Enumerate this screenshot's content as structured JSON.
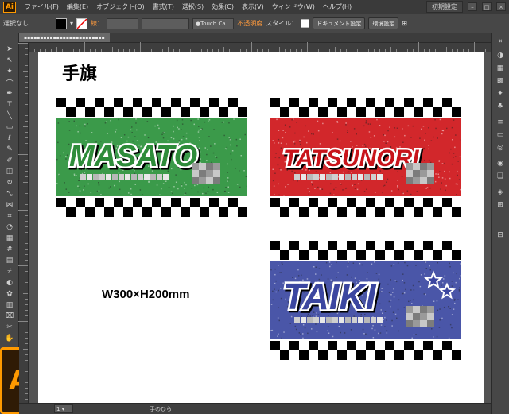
{
  "app": {
    "logo_text": "Ai"
  },
  "menu": {
    "items": [
      "ファイル(F)",
      "編集(E)",
      "オブジェクト(O)",
      "書式(T)",
      "選択(S)",
      "効果(C)",
      "表示(V)",
      "ウィンドウ(W)",
      "ヘルプ(H)"
    ],
    "workspace": "初期設定"
  },
  "control": {
    "selection_label": "選択なし",
    "stroke_label": "線：",
    "brush_value": "Touch Ca...",
    "opacity_label": "不透明度",
    "style_label": "スタイル：",
    "doc_settings": "ドキュメント設定",
    "env_settings": "環境設定"
  },
  "status": {
    "tool_name": "手のひら"
  },
  "artboard": {
    "title": "手旗",
    "size_text": "W300×H200mm",
    "flags": [
      {
        "name": "MASATO",
        "bg": "#3b9a4a",
        "text_color": "#2e8c3a"
      },
      {
        "name": "TATSUNORI",
        "bg": "#d2272b",
        "text_color": "#c8141b"
      },
      {
        "name": "TAIKI",
        "bg": "#4a56a8",
        "text_color": "#3b46a0"
      }
    ]
  },
  "colors": {
    "accent": "#ff9a00",
    "chrome": "#535353"
  }
}
